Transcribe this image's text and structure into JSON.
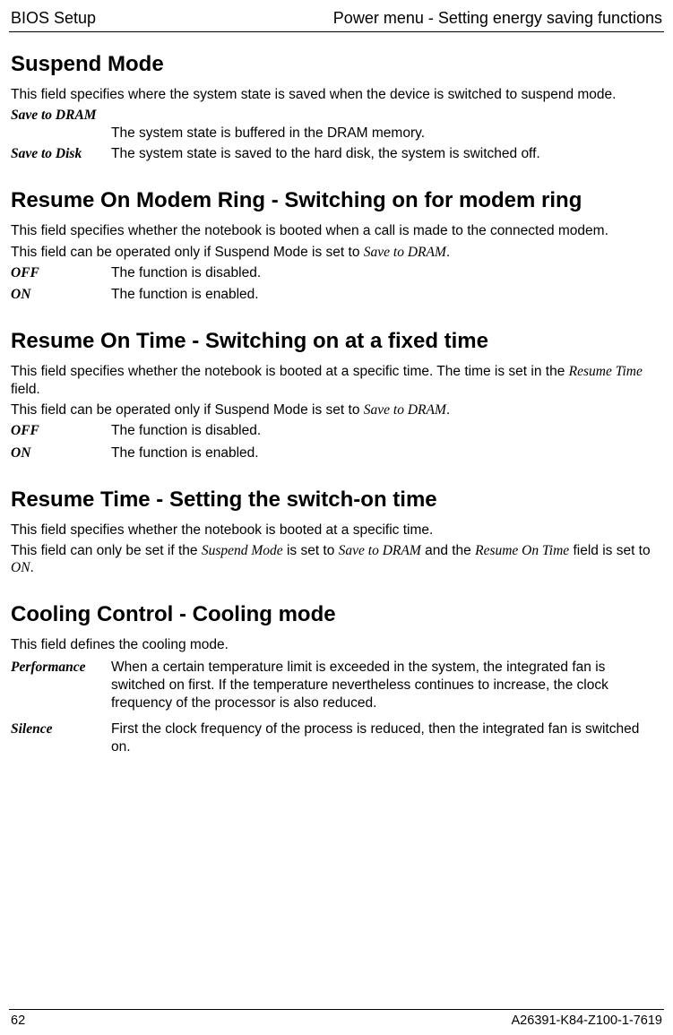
{
  "header": {
    "left": "BIOS Setup",
    "right": "Power menu - Setting energy saving functions"
  },
  "sections": {
    "suspend": {
      "title": "Suspend Mode",
      "intro": "This field specifies where the system state is saved when the device is switched to suspend mode.",
      "defs": [
        {
          "term": "Save to DRAM",
          "desc": "The system state is buffered in the DRAM memory.",
          "stacked": true
        },
        {
          "term": "Save to Disk",
          "desc": "The system state is saved to the hard disk, the system is switched off."
        }
      ]
    },
    "modemRing": {
      "title": "Resume On Modem Ring - Switching on for modem ring",
      "para1": "This field specifies whether the notebook is booted when a call is made to the connected modem.",
      "para2_a": "This field can be operated only if Suspend Mode is set to ",
      "para2_b": "Save to DRAM",
      "para2_c": ".",
      "defs": [
        {
          "term": "OFF",
          "desc": "The function is disabled."
        },
        {
          "term": "ON",
          "desc": "The function is enabled."
        }
      ]
    },
    "resumeOnTime": {
      "title": "Resume On Time - Switching on at a fixed time",
      "para1_a": "This field specifies whether the notebook is booted at a specific time. The time is set in the ",
      "para1_b": "Resume Time",
      "para1_c": " field.",
      "para2_a": "This field can be operated only if Suspend Mode is set to ",
      "para2_b": "Save to DRAM",
      "para2_c": ".",
      "defs": [
        {
          "term": "OFF",
          "desc": "The function is disabled."
        },
        {
          "term": "ON",
          "desc": "The function is enabled."
        }
      ]
    },
    "resumeTime": {
      "title": "Resume Time - Setting the switch-on time",
      "para1": "This field specifies whether the notebook is booted at a specific time.",
      "para2_a": "This field can only be set if the ",
      "para2_b": "Suspend Mode",
      "para2_c": " is set to ",
      "para2_d": "Save to DRAM",
      "para2_e": " and the ",
      "para2_f": "Resume On Time",
      "para2_g": " field is set to ",
      "para2_h": "ON",
      "para2_i": "."
    },
    "cooling": {
      "title": "Cooling Control - Cooling mode",
      "intro": "This field defines the cooling mode.",
      "defs": [
        {
          "term": "Performance",
          "desc": "When a certain temperature limit is exceeded in the system, the integrated fan is switched on first. If the temperature nevertheless continues to increase, the clock frequency of the processor is also reduced."
        },
        {
          "term": "Silence",
          "desc": "First the clock frequency of the process is reduced, then the integrated fan is switched on."
        }
      ]
    }
  },
  "footer": {
    "page": "62",
    "doc": "A26391-K84-Z100-1-7619"
  }
}
